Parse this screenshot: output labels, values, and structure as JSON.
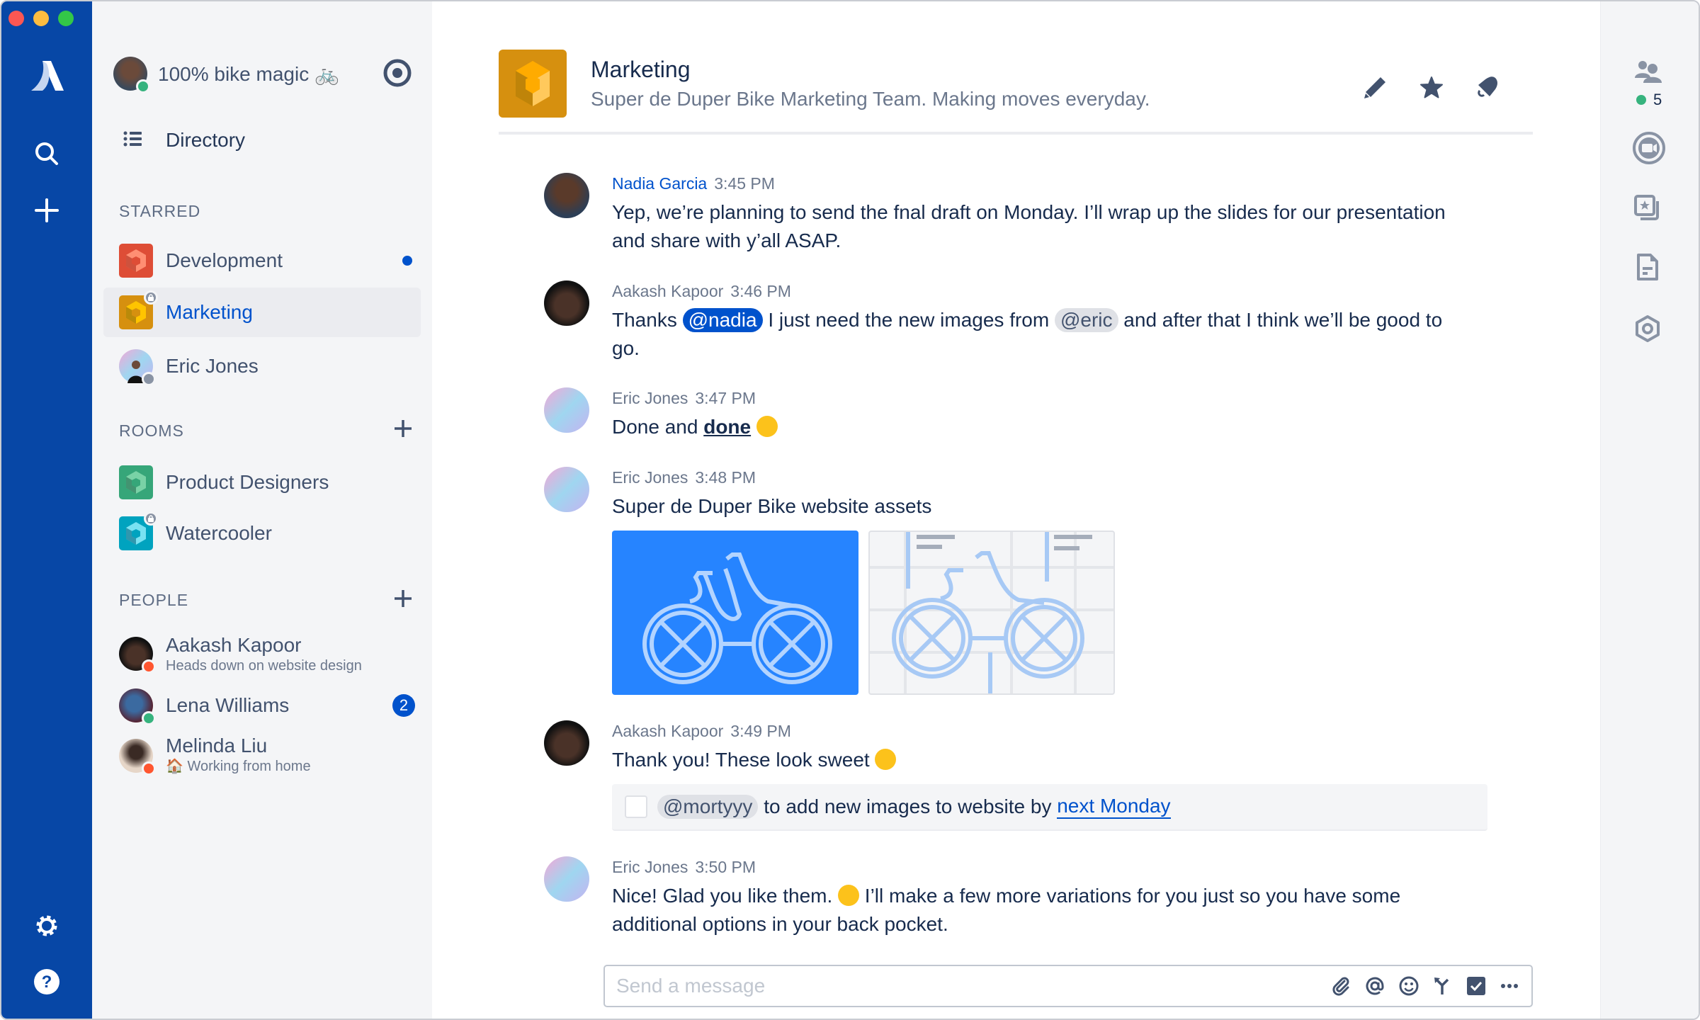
{
  "window": {
    "traffic_lights": [
      "close",
      "minimize",
      "maximize"
    ]
  },
  "global_nav": {
    "logo": "atlassian-logo-icon",
    "top_icons": [
      "search-icon",
      "plus-icon"
    ],
    "bottom_icons": [
      "gear-icon",
      "help-icon"
    ],
    "color": "#0747a6"
  },
  "sidebar": {
    "profile": {
      "status_text": "100% bike magic 🚲",
      "presence": "online"
    },
    "directory_label": "Directory",
    "sections": {
      "starred": {
        "title": "STARRED",
        "items": [
          {
            "label": "Development",
            "color": "#de4d36",
            "unread": true
          },
          {
            "label": "Marketing",
            "color": "#d6900f",
            "selected": true,
            "private": true
          },
          {
            "label": "Eric Jones",
            "type": "person",
            "presence": "offline"
          }
        ]
      },
      "rooms": {
        "title": "ROOMS",
        "items": [
          {
            "label": "Product Designers",
            "color": "#36a679"
          },
          {
            "label": "Watercooler",
            "color": "#00a3bf",
            "private": true
          }
        ]
      },
      "people": {
        "title": "PEOPLE",
        "items": [
          {
            "name": "Aakash Kapoor",
            "status": "Heads down on website design",
            "presence": "dnd"
          },
          {
            "name": "Lena Williams",
            "presence": "online",
            "badge": "2"
          },
          {
            "name": "Melinda Liu",
            "status": "🏠 Working from home",
            "presence": "dnd"
          }
        ]
      }
    }
  },
  "header": {
    "title": "Marketing",
    "description": "Super de Duper Bike Marketing Team. Making moves everyday.",
    "actions": [
      "edit-icon",
      "star-icon",
      "notifications-icon"
    ]
  },
  "messages": [
    {
      "author": "Nadia Garcia",
      "time": "3:45 PM",
      "self": true,
      "text": "Yep, we’re planning to send the fnal draft on Monday. I’ll wrap up the slides for our presentation and share with y’all ASAP."
    },
    {
      "author": "Aakash Kapoor",
      "time": "3:46 PM",
      "parts": {
        "t1": "Thanks ",
        "mention1": "@nadia",
        "t2": " I just need the new images from ",
        "mention2": "@eric",
        "t3": " and after that I think we’ll be good to go."
      }
    },
    {
      "author": "Eric Jones",
      "time": "3:47 PM",
      "parts": {
        "t1": "Done and ",
        "bold": "done"
      }
    },
    {
      "author": "Eric Jones",
      "time": "3:48 PM",
      "text": "Super de Duper Bike website assets",
      "attachments": [
        "bike-illustration-blue",
        "bike-illustration-wireframe"
      ]
    },
    {
      "author": "Aakash Kapoor",
      "time": "3:49 PM",
      "text": "Thank you! These look sweet",
      "task": {
        "checked": false,
        "mention": "@mortyyy",
        "text": " to add new images to website by ",
        "date": "next Monday"
      }
    },
    {
      "author": "Eric Jones",
      "time": "3:50 PM",
      "parts": {
        "t1": "Nice! Glad you like them. ",
        "t2": " I’ll make a few more variations for you just so you have some additional options in your back pocket."
      }
    }
  ],
  "composer": {
    "placeholder": "Send a message",
    "value": "",
    "tools": [
      "attach-icon",
      "mention-icon",
      "emoji-icon",
      "decision-icon",
      "task-icon",
      "more-icon"
    ]
  },
  "right_rail": {
    "participants_online": "5",
    "icons": [
      "participants-icon",
      "video-call-icon",
      "files-icon",
      "document-icon",
      "settings-icon"
    ]
  }
}
